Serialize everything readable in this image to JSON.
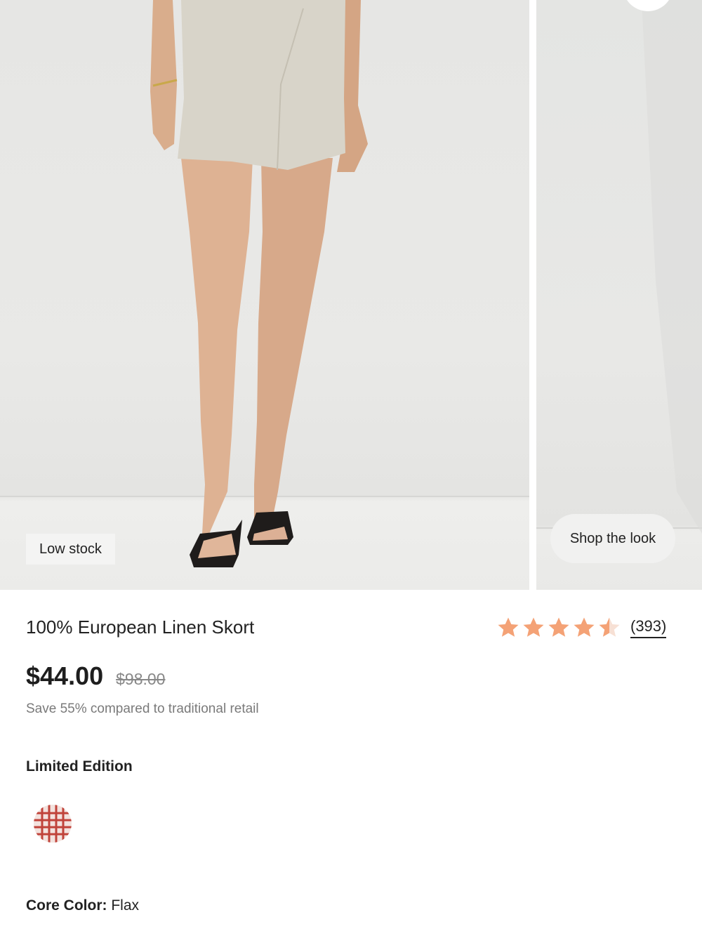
{
  "gallery": {
    "badge": "Low stock",
    "shop_the_look": "Shop the look"
  },
  "product": {
    "title": "100% European Linen Skort",
    "rating": 4.5,
    "review_count": "(393)",
    "price": "$44.00",
    "original_price": "$98.00",
    "savings_text": "Save 55% compared to traditional retail"
  },
  "limited_edition": {
    "label": "Limited Edition",
    "swatch_color": "#c0433a"
  },
  "core_color": {
    "label": "Core Color:",
    "value": "Flax"
  },
  "colors": {
    "star": "#f4a276",
    "star_empty": "#f7e0d4"
  }
}
